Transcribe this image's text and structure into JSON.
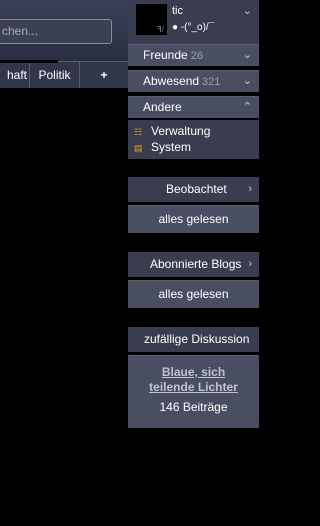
{
  "search": {
    "placeholder_partial": "chen..."
  },
  "tabs": [
    "haft",
    "Politik",
    "+"
  ],
  "user": {
    "name": "tic",
    "status": "● -(°_o)/¯"
  },
  "friends": {
    "label": "Freunde",
    "count": "26"
  },
  "away": {
    "label": "Abwesend",
    "count": "321"
  },
  "other": {
    "label": "Andere"
  },
  "other_items": [
    {
      "label": "Verwaltung",
      "icon": "admin-icon"
    },
    {
      "label": "System",
      "icon": "system-icon"
    }
  ],
  "watched": {
    "label": "Beobachtet",
    "action": "alles gelesen"
  },
  "subscribed": {
    "label": "Abonnierte Blogs",
    "action": "alles gelesen"
  },
  "random": {
    "label": "zufällige Diskussion",
    "link": "Blaue, sich teilende Lichter",
    "posts": "146 Beiträge"
  },
  "colors": {
    "accent": "#e4a11a",
    "panel": "#3a3d4f",
    "panel_light": "#4a4e62"
  }
}
